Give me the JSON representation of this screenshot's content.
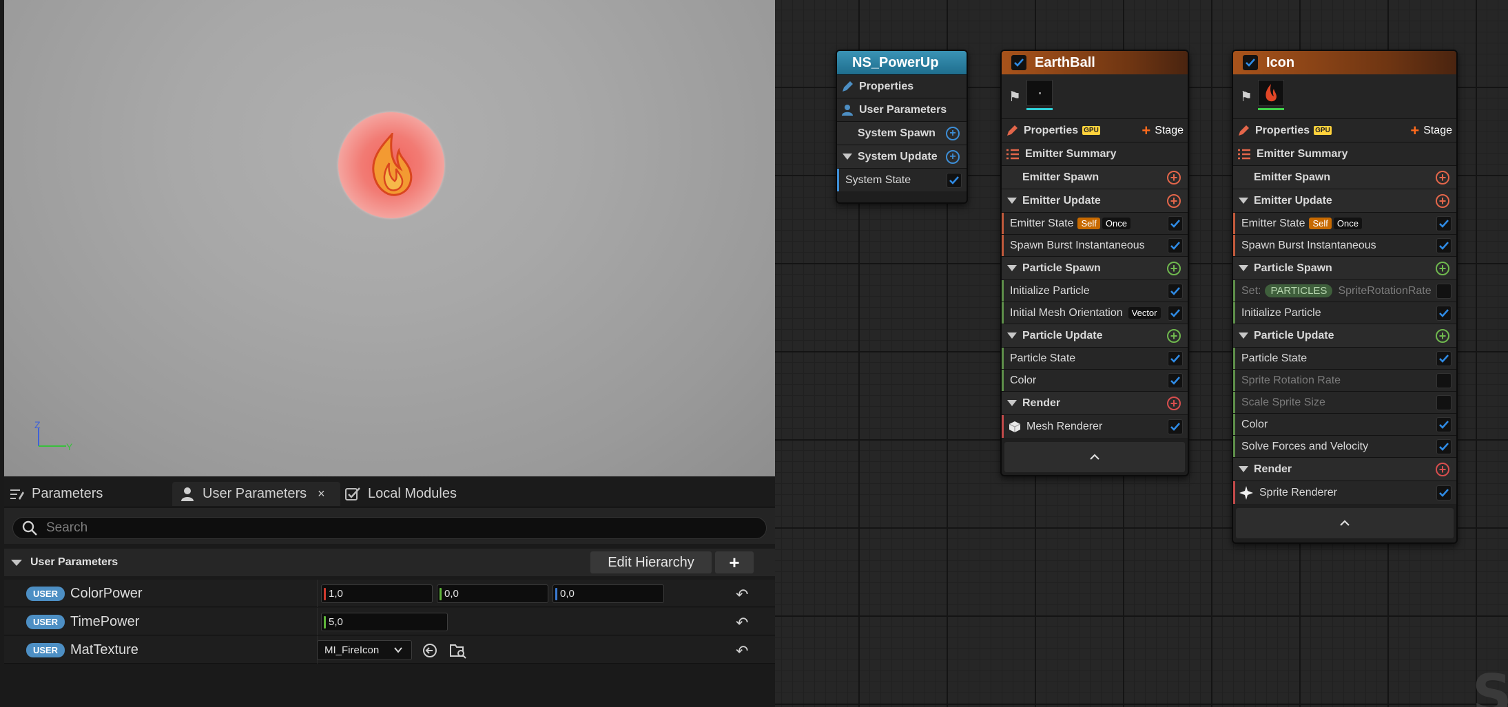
{
  "viewport": {},
  "tabs": {
    "parameters": "Parameters",
    "user_parameters": "User Parameters",
    "local_modules": "Local Modules",
    "close": "×"
  },
  "search": {
    "placeholder": "Search"
  },
  "category": {
    "title": "User Parameters",
    "edit_hierarchy": "Edit Hierarchy",
    "add": "+"
  },
  "params": [
    {
      "badge": "USER",
      "name": "ColorPower",
      "values": [
        "1,0",
        "0,0",
        "0,0"
      ]
    },
    {
      "badge": "USER",
      "name": "TimePower",
      "values": [
        "5,0"
      ]
    },
    {
      "badge": "USER",
      "name": "MatTexture",
      "value": "MI_FireIcon"
    }
  ],
  "graph": {
    "watermark": "SY",
    "system_node": {
      "title": "NS_PowerUp",
      "rows": [
        "Properties",
        "User Parameters",
        "System Spawn",
        "System Update",
        "System State"
      ]
    },
    "earthball": {
      "title": "EarthBall",
      "properties": "Properties",
      "gpu": "GPU",
      "stage": "Stage",
      "emitter_summary": "Emitter Summary",
      "emitter_spawn": "Emitter Spawn",
      "emitter_update": "Emitter Update",
      "emitter_state": "Emitter State",
      "self": "Self",
      "once": "Once",
      "spawn_burst": "Spawn Burst Instantaneous",
      "particle_spawn": "Particle Spawn",
      "initialize_particle": "Initialize Particle",
      "initial_mesh_orientation": "Initial Mesh Orientation",
      "vector": "Vector",
      "particle_update": "Particle Update",
      "particle_state": "Particle State",
      "color": "Color",
      "render": "Render",
      "mesh_renderer": "Mesh Renderer"
    },
    "icon": {
      "title": "Icon",
      "properties": "Properties",
      "gpu": "GPU",
      "stage": "Stage",
      "emitter_summary": "Emitter Summary",
      "emitter_spawn": "Emitter Spawn",
      "emitter_update": "Emitter Update",
      "emitter_state": "Emitter State",
      "self": "Self",
      "once": "Once",
      "spawn_burst": "Spawn Burst Instantaneous",
      "particle_spawn": "Particle Spawn",
      "set_label": "Set:",
      "particles": "PARTICLES",
      "sprite_rotation_rate_param": "SpriteRotationRate",
      "initialize_particle": "Initialize Particle",
      "particle_update": "Particle Update",
      "particle_state": "Particle State",
      "sprite_rotation_rate": "Sprite Rotation Rate",
      "scale_sprite_size": "Scale Sprite Size",
      "color": "Color",
      "solve_forces": "Solve Forces and Velocity",
      "render": "Render",
      "sprite_renderer": "Sprite Renderer"
    }
  },
  "colors": {
    "system_header": "#2b7fa3",
    "emitter_header": "#9a4d18",
    "check_blue": "#2f8be5",
    "accent_orange": "#ff6a1c"
  }
}
